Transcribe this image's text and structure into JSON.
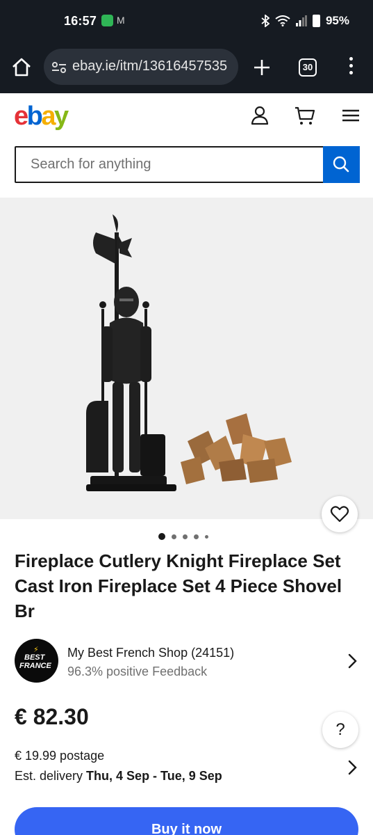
{
  "status_bar": {
    "time": "16:57",
    "battery": "95%",
    "icons": [
      "notification-app-icon",
      "gmail-icon",
      "bluetooth-icon",
      "wifi-icon",
      "signal-icon",
      "battery-icon"
    ]
  },
  "browser": {
    "url": "ebay.ie/itm/13616457535",
    "tab_count": "30",
    "icons": [
      "home-icon",
      "site-settings-icon",
      "new-tab-icon",
      "tabs-icon",
      "overflow-menu-icon"
    ]
  },
  "header": {
    "logo": [
      "e",
      "b",
      "a",
      "y"
    ],
    "icons": [
      "account-icon",
      "cart-icon",
      "hamburger-menu-icon"
    ]
  },
  "search": {
    "placeholder": "Search for anything",
    "value": ""
  },
  "gallery": {
    "image_count": 5,
    "active_index": 0
  },
  "product": {
    "title": "Fireplace Cutlery Knight Fireplace Set Cast Iron Fireplace Set 4 Piece Shovel Br"
  },
  "seller": {
    "logo_line1": "BEST",
    "logo_line2": "FRANCE",
    "name": "My Best French Shop (24151)",
    "feedback": "96.3% positive Feedback"
  },
  "pricing": {
    "price": "€ 82.30",
    "postage": "€ 19.99 postage",
    "delivery_prefix": "Est. delivery ",
    "delivery_dates": "Thu, 4 Sep - Tue, 9 Sep",
    "help": "?"
  },
  "actions": {
    "buy_now": "Buy it now"
  },
  "colors": {
    "ebay_red": "#e53238",
    "ebay_blue": "#0064d2",
    "ebay_yellow": "#f5af02",
    "ebay_green": "#86b817",
    "buy_button": "#3665f3",
    "status_bar_bg": "#161b22"
  }
}
